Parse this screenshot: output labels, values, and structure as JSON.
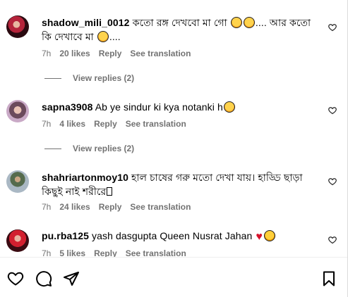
{
  "comments": [
    {
      "username": "shadow_mili_0012",
      "text_a": "কতো রঙ্গ দেখবো মা গো",
      "text_b": ".... আর কতো কি দেখাবে মা",
      "text_c": "....",
      "time": "7h",
      "likes": "20 likes",
      "reply": "Reply",
      "translate": "See translation",
      "view_replies": "View replies (2)"
    },
    {
      "username": "sapna3908",
      "text_a": "Ab ye sindur ki kya notanki h",
      "time": "7h",
      "likes": "4 likes",
      "reply": "Reply",
      "translate": "See translation",
      "view_replies": "View replies (2)"
    },
    {
      "username": "shahriartonmoy10",
      "text_a": "হাল চাষের গরু মতো দেখা যায়। হাড্ডি ছাড়া কিছুই নাই শরীরে",
      "time": "7h",
      "likes": "24 likes",
      "reply": "Reply",
      "translate": "See translation"
    },
    {
      "username": "pu.rba125",
      "text_a": "yash dasgupta Queen Nusrat Jahan",
      "time": "7h",
      "likes": "5 likes",
      "reply": "Reply",
      "translate": "See translation"
    }
  ],
  "icons": {
    "like": "heart-outline-icon",
    "comment": "comment-bubble-icon",
    "share": "paper-plane-icon",
    "save": "bookmark-icon"
  },
  "colors": {
    "meta_gray": "#737373",
    "emoji_heart": "#d6102a"
  }
}
